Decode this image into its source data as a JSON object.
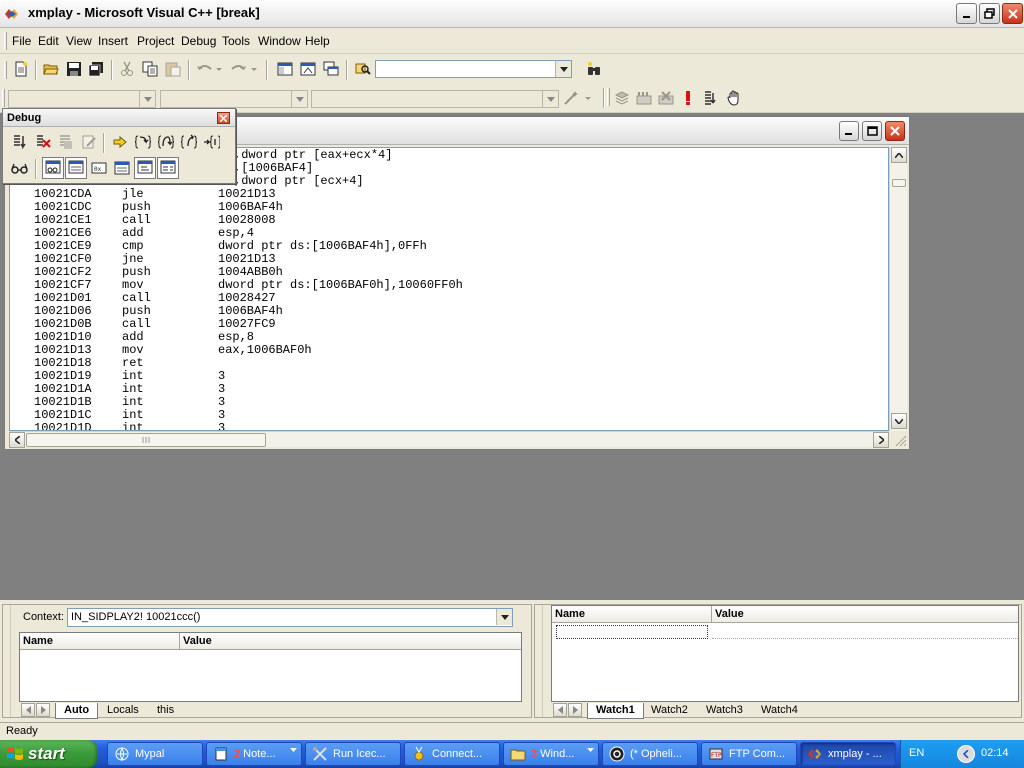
{
  "window": {
    "title": "xmplay - Microsoft Visual C++ [break]"
  },
  "menu": [
    "File",
    "Edit",
    "View",
    "Insert",
    "Project",
    "Debug",
    "Tools",
    "Window",
    "Help"
  ],
  "toolbar": {
    "find_combo_value": ""
  },
  "debug_toolbar": {
    "title": "Debug"
  },
  "disassembly": {
    "partial_lines": [
      {
        "arg": ",dword ptr [eax+ecx*4]"
      },
      {
        "arg": ",[1006BAF4]"
      },
      {
        "arg": ",dword ptr [ecx+4]"
      }
    ],
    "lines": [
      {
        "addr": "10021CDA",
        "op": "jle",
        "arg": "10021D13"
      },
      {
        "addr": "10021CDC",
        "op": "push",
        "arg": "1006BAF4h"
      },
      {
        "addr": "10021CE1",
        "op": "call",
        "arg": "10028008"
      },
      {
        "addr": "10021CE6",
        "op": "add",
        "arg": "esp,4"
      },
      {
        "addr": "10021CE9",
        "op": "cmp",
        "arg": "dword ptr ds:[1006BAF4h],0FFh"
      },
      {
        "addr": "10021CF0",
        "op": "jne",
        "arg": "10021D13"
      },
      {
        "addr": "10021CF2",
        "op": "push",
        "arg": "1004ABB0h"
      },
      {
        "addr": "10021CF7",
        "op": "mov",
        "arg": "dword ptr ds:[1006BAF0h],10060FF0h"
      },
      {
        "addr": "10021D01",
        "op": "call",
        "arg": "10028427"
      },
      {
        "addr": "10021D06",
        "op": "push",
        "arg": "1006BAF4h"
      },
      {
        "addr": "10021D0B",
        "op": "call",
        "arg": "10027FC9"
      },
      {
        "addr": "10021D10",
        "op": "add",
        "arg": "esp,8"
      },
      {
        "addr": "10021D13",
        "op": "mov",
        "arg": "eax,1006BAF0h"
      },
      {
        "addr": "10021D18",
        "op": "ret",
        "arg": ""
      },
      {
        "addr": "10021D19",
        "op": "int",
        "arg": "3"
      },
      {
        "addr": "10021D1A",
        "op": "int",
        "arg": "3"
      },
      {
        "addr": "10021D1B",
        "op": "int",
        "arg": "3"
      },
      {
        "addr": "10021D1C",
        "op": "int",
        "arg": "3"
      },
      {
        "addr": "10021D1D",
        "op": "int",
        "arg": "3"
      }
    ]
  },
  "variables_pane": {
    "context_label": "Context:",
    "context_value": "IN_SIDPLAY2! 10021ccc()",
    "col_name": "Name",
    "col_value": "Value",
    "tabs": [
      "Auto",
      "Locals",
      "this"
    ]
  },
  "watch_pane": {
    "col_name": "Name",
    "col_value": "Value",
    "tabs": [
      "Watch1",
      "Watch2",
      "Watch3",
      "Watch4"
    ]
  },
  "status": {
    "text": "Ready"
  },
  "taskbar": {
    "start_label": "start",
    "tasks": [
      {
        "label": "Mypal",
        "count": ""
      },
      {
        "label": "Note...",
        "count": "2"
      },
      {
        "label": "Run Icec...",
        "count": ""
      },
      {
        "label": "Connect...",
        "count": ""
      },
      {
        "label": "Wind...",
        "count": "3"
      },
      {
        "label": "(* Opheli...",
        "count": ""
      },
      {
        "label": "FTP Com...",
        "count": ""
      },
      {
        "label": "xmplay - ...",
        "count": ""
      }
    ],
    "lang": "EN",
    "clock": "02:14"
  }
}
